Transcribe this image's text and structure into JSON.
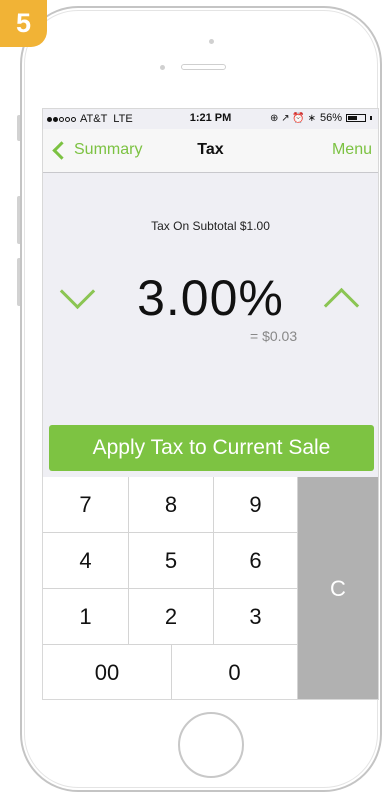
{
  "badge": {
    "step": "5"
  },
  "status_bar": {
    "carrier": "AT&T",
    "network": "LTE",
    "time": "1:21 PM",
    "status_icons": "⊕ ↗ ⏰ ∗",
    "battery": "56%",
    "battery_level": 0.56
  },
  "nav": {
    "back_label": "Summary",
    "title": "Tax",
    "menu_label": "Menu"
  },
  "tax": {
    "caption": "Tax On Subtotal $1.00",
    "percent": "3.00%",
    "amount": "= $0.03"
  },
  "actions": {
    "apply_label": "Apply Tax to Current Sale"
  },
  "keypad": {
    "keys": [
      "7",
      "8",
      "9",
      "4",
      "5",
      "6",
      "1",
      "2",
      "3",
      "00",
      "0"
    ],
    "clear_label": "C"
  },
  "colors": {
    "accent": "#7dc342",
    "badge": "#f1b336",
    "clear_key": "#b1b1b1"
  }
}
